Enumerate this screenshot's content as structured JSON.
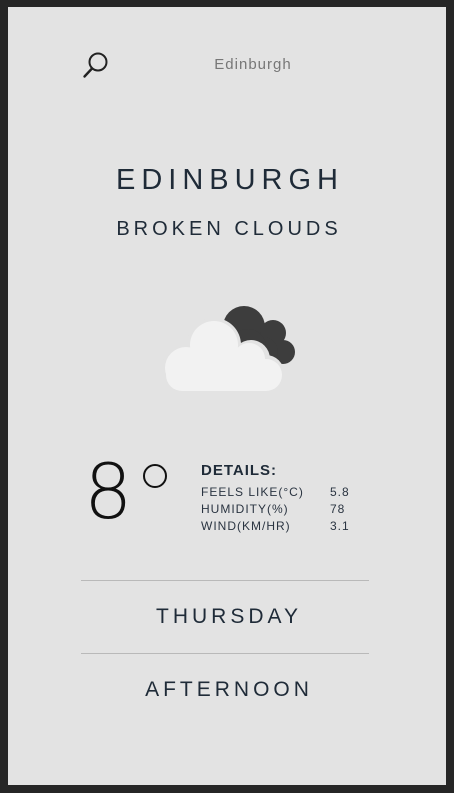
{
  "search": {
    "value": "Edinburgh",
    "icon": "search-icon"
  },
  "location": {
    "city": "EDINBURGH",
    "condition": "BROKEN CLOUDS"
  },
  "weather_icon": "broken-clouds-icon",
  "current": {
    "temperature": "8"
  },
  "details": {
    "title": "DETAILS:",
    "rows": [
      {
        "label": "FEELS LIKE(°C)",
        "value": "5.8"
      },
      {
        "label": "HUMIDITY(%)",
        "value": "78"
      },
      {
        "label": "WIND(KM/HR)",
        "value": "3.1"
      }
    ]
  },
  "forecast": {
    "day": "THURSDAY",
    "time_of_day": "AFTERNOON"
  },
  "colors": {
    "background": "#e3e3e3",
    "frame": "#262626",
    "text": "#1f2b38",
    "cloud_light": "#f2f2f2",
    "cloud_dark": "#3d3d3d"
  }
}
